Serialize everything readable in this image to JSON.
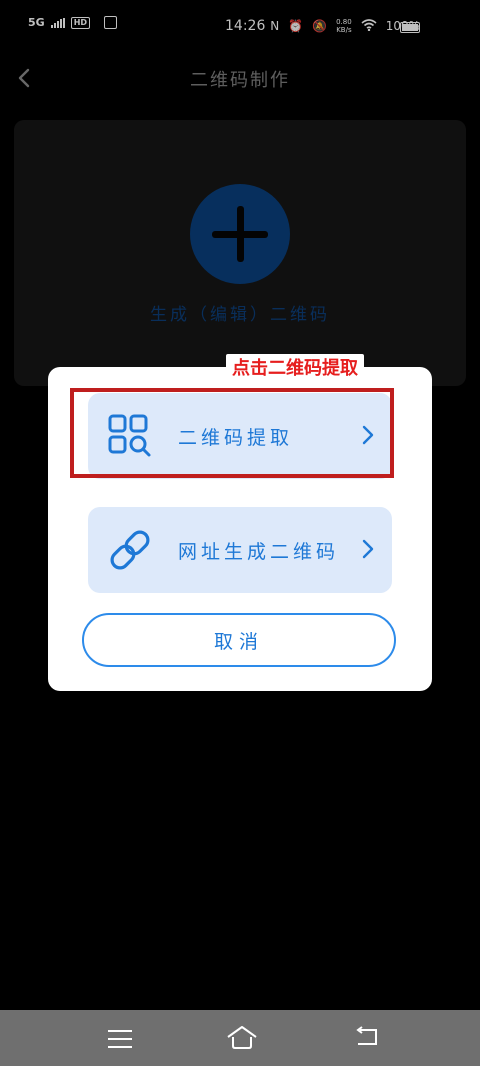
{
  "status_bar": {
    "network": "5G",
    "hd": "HD",
    "time": "14:26",
    "speed_value": "0.80",
    "speed_unit": "KB/s",
    "battery": "100%"
  },
  "header": {
    "back_glyph": "‹",
    "title": "二维码制作"
  },
  "card": {
    "label": "生成（编辑）二维码"
  },
  "dialog": {
    "option1_label": "二维码提取",
    "option2_label": "网址生成二维码",
    "chevron": "〉",
    "cancel_label": "取消"
  },
  "annotation": {
    "label": "点击二维码提取",
    "color": "#bf1e1e"
  },
  "colors": {
    "accent": "#1e78d6",
    "option_bg": "#dde9fa",
    "plus_circle": "#0a3f7c"
  }
}
